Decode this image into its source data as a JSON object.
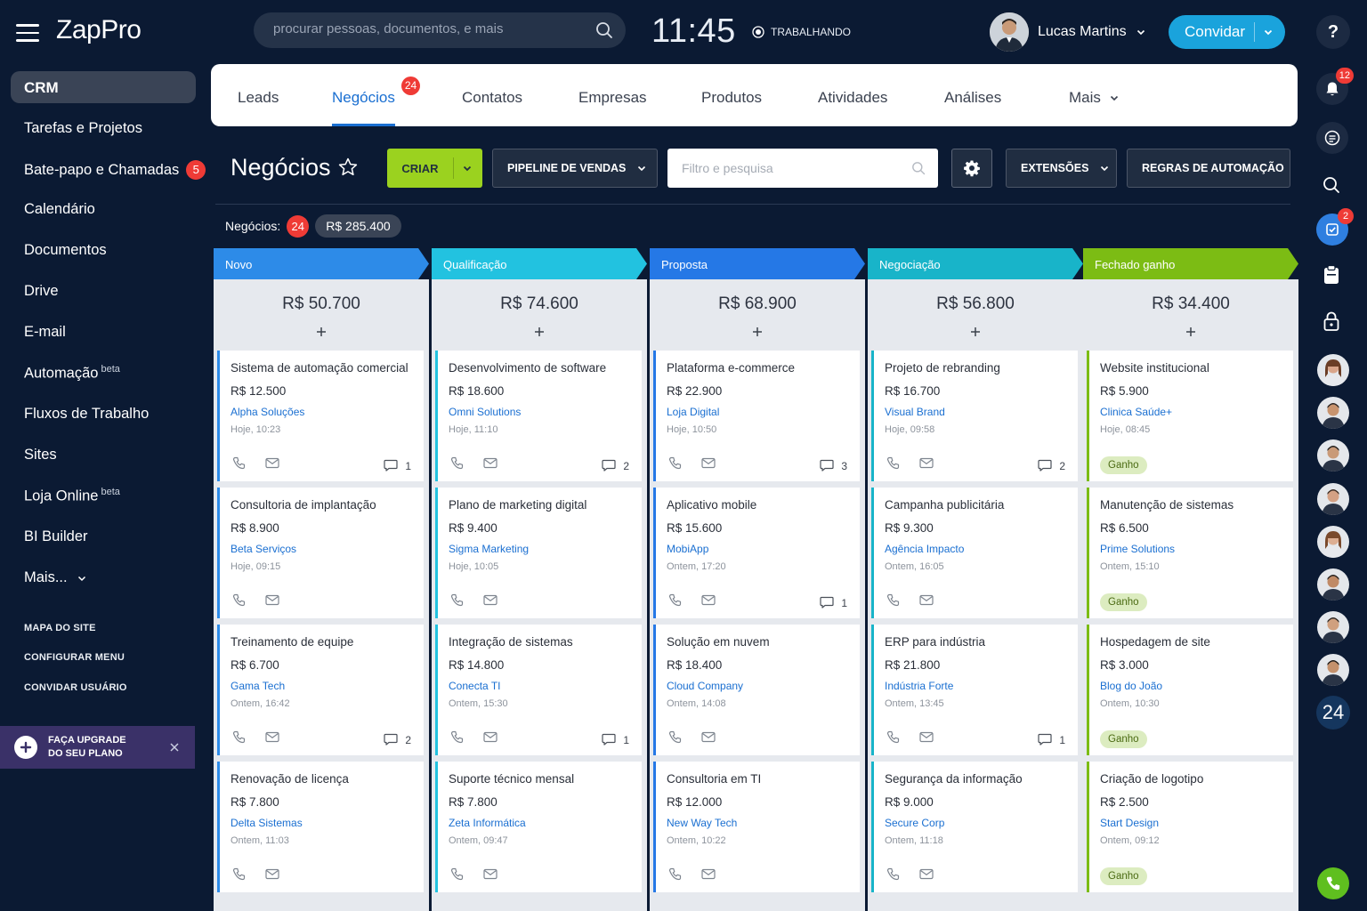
{
  "app": {
    "name": "ZapPro"
  },
  "header": {
    "search_placeholder": "procurar pessoas, documentos, e mais",
    "clock": "11:45",
    "work_status": "TRABALHANDO",
    "user_name": "Lucas Martins",
    "invite_label": "Convidar",
    "help_label": "?"
  },
  "sidebar": {
    "active": "CRM",
    "items": [
      {
        "label": "Tarefas e Projetos"
      },
      {
        "label": "Bate-papo e Chamadas",
        "badge": "5"
      },
      {
        "label": "Calendário"
      },
      {
        "label": "Documentos"
      },
      {
        "label": "Drive"
      },
      {
        "label": "E-mail"
      },
      {
        "label": "Automação",
        "tag": "beta"
      },
      {
        "label": "Fluxos de Trabalho"
      },
      {
        "label": "Sites"
      },
      {
        "label": "Loja Online",
        "tag": "beta"
      },
      {
        "label": "BI Builder"
      },
      {
        "label": "Mais..."
      }
    ],
    "links": [
      "MAPA DO SITE",
      "CONFIGURAR MENU",
      "CONVIDAR USUÁRIO"
    ],
    "upgrade": {
      "line1": "FAÇA UPGRADE",
      "line2": "DO SEU PLANO"
    }
  },
  "tabs": {
    "items": [
      "Leads",
      "Negócios",
      "Contatos",
      "Empresas",
      "Produtos",
      "Atividades",
      "Análises",
      "Mais"
    ],
    "active": "Negócios",
    "active_badge": "24"
  },
  "toolbar": {
    "title": "Negócios",
    "create_label": "CRIAR",
    "pipeline_label": "PIPELINE DE VENDAS",
    "filter_placeholder": "Filtro e pesquisa",
    "extensions_label": "EXTENSÕES",
    "automation_label": "REGRAS DE AUTOMAÇÃO"
  },
  "summary": {
    "label": "Negócios:",
    "count": "24",
    "total": "R$ 285.400"
  },
  "board": {
    "columns": [
      {
        "name": "Novo",
        "color": "#2d8be8",
        "total": "R$ 50.700",
        "cards": [
          {
            "title": "Sistema de automação comercial",
            "amount": "R$ 12.500",
            "company": "Alpha Soluções",
            "time": "Hoje, 10:23",
            "comments": "1"
          },
          {
            "title": "Consultoria de implantação",
            "amount": "R$ 8.900",
            "company": "Beta Serviços",
            "time": "Hoje, 09:15",
            "comments": ""
          },
          {
            "title": "Treinamento de equipe",
            "amount": "R$ 6.700",
            "company": "Gama Tech",
            "time": "Ontem, 16:42",
            "comments": "2"
          },
          {
            "title": "Renovação de licença",
            "amount": "R$ 7.800",
            "company": "Delta Sistemas",
            "time": "Ontem, 11:03",
            "comments": ""
          }
        ]
      },
      {
        "name": "Qualificação",
        "color": "#22c2e0",
        "total": "R$ 74.600",
        "cards": [
          {
            "title": "Desenvolvimento de software",
            "amount": "R$ 18.600",
            "company": "Omni Solutions",
            "time": "Hoje, 11:10",
            "comments": "2"
          },
          {
            "title": "Plano de marketing digital",
            "amount": "R$ 9.400",
            "company": "Sigma Marketing",
            "time": "Hoje, 10:05",
            "comments": ""
          },
          {
            "title": "Integração de sistemas",
            "amount": "R$ 14.800",
            "company": "Conecta TI",
            "time": "Ontem, 15:30",
            "comments": "1"
          },
          {
            "title": "Suporte técnico mensal",
            "amount": "R$ 7.800",
            "company": "Zeta Informática",
            "time": "Ontem, 09:47",
            "comments": ""
          }
        ]
      },
      {
        "name": "Proposta",
        "color": "#2578e6",
        "total": "R$ 68.900",
        "cards": [
          {
            "title": "Plataforma e-commerce",
            "amount": "R$ 22.900",
            "company": "Loja Digital",
            "time": "Hoje, 10:50",
            "comments": "3"
          },
          {
            "title": "Aplicativo mobile",
            "amount": "R$ 15.600",
            "company": "MobiApp",
            "time": "Ontem, 17:20",
            "comments": "1"
          },
          {
            "title": "Solução em nuvem",
            "amount": "R$ 18.400",
            "company": "Cloud Company",
            "time": "Ontem, 14:08",
            "comments": ""
          },
          {
            "title": "Consultoria em TI",
            "amount": "R$ 12.000",
            "company": "New Way Tech",
            "time": "Ontem, 10:22",
            "comments": ""
          }
        ]
      },
      {
        "name": "Negociação",
        "color": "#18b4c9",
        "total": "R$ 56.800",
        "cards": [
          {
            "title": "Projeto de rebranding",
            "amount": "R$ 16.700",
            "company": "Visual Brand",
            "time": "Hoje, 09:58",
            "comments": "2"
          },
          {
            "title": "Campanha publicitária",
            "amount": "R$ 9.300",
            "company": "Agência Impacto",
            "time": "Ontem, 16:05",
            "comments": ""
          },
          {
            "title": "ERP para indústria",
            "amount": "R$ 21.800",
            "company": "Indústria Forte",
            "time": "Ontem, 13:45",
            "comments": "1"
          },
          {
            "title": "Segurança da informação",
            "amount": "R$ 9.000",
            "company": "Secure Corp",
            "time": "Ontem, 11:18",
            "comments": ""
          }
        ]
      },
      {
        "name": "Fechado ganho",
        "color": "#7cbc14",
        "total": "R$ 34.400",
        "cards": [
          {
            "title": "Website institucional",
            "amount": "R$ 5.900",
            "company": "Clinica Saúde+",
            "time": "Hoje, 08:45",
            "won": "Ganho"
          },
          {
            "title": "Manutenção de sistemas",
            "amount": "R$ 6.500",
            "company": "Prime Solutions",
            "time": "Ontem, 15:10",
            "won": "Ganho"
          },
          {
            "title": "Hospedagem de site",
            "amount": "R$ 3.000",
            "company": "Blog do João",
            "time": "Ontem, 10:30",
            "won": "Ganho"
          },
          {
            "title": "Criação de logotipo",
            "amount": "R$ 2.500",
            "company": "Start Design",
            "time": "Ontem, 09:12",
            "won": "Ganho"
          }
        ]
      }
    ]
  },
  "rightbar": {
    "notifications_badge": "12",
    "tasks_badge": "2",
    "online_count": "24"
  },
  "colors": {
    "background": "#0b1a33",
    "accent": "#1a6fd1",
    "create": "#9bd21f",
    "danger": "#ef3b36",
    "won": "#7cbc14",
    "phone": "#5fbf1f"
  }
}
